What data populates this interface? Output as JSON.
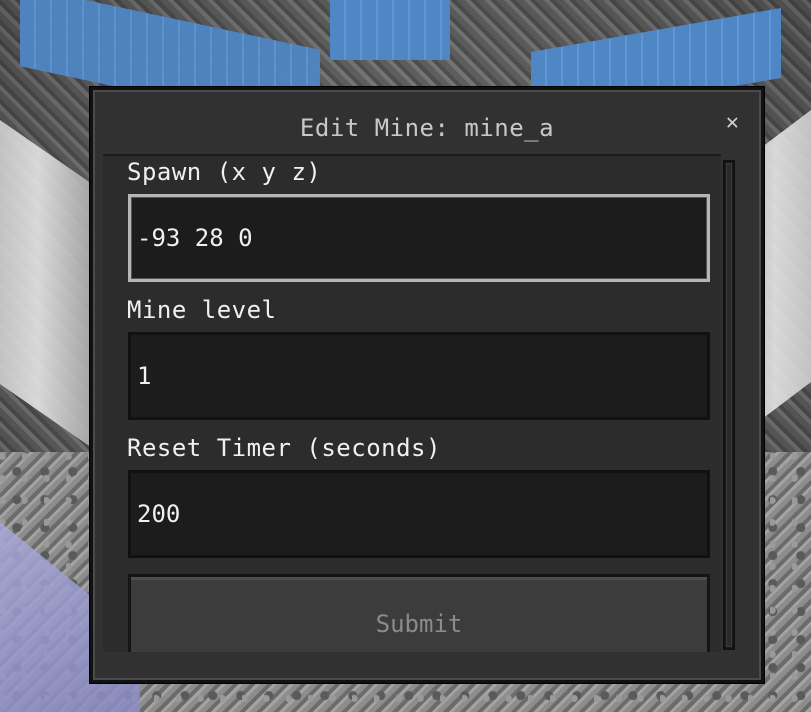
{
  "dialog": {
    "title": "Edit Mine: mine_a",
    "close_icon": "close-icon"
  },
  "fields": [
    {
      "label": "Spawn (x y z)",
      "value": "-93 28 0",
      "focused": true
    },
    {
      "label": "Mine level",
      "value": "1",
      "focused": false
    },
    {
      "label": "Reset Timer (seconds)",
      "value": "200",
      "focused": false
    }
  ],
  "submit": {
    "label": "Submit"
  },
  "colors": {
    "panel": "#313131",
    "input_bg": "#1c1c1c",
    "text": "#f0f0f0",
    "title_text": "#c8c8c8",
    "button_text": "#8b8b8b"
  }
}
